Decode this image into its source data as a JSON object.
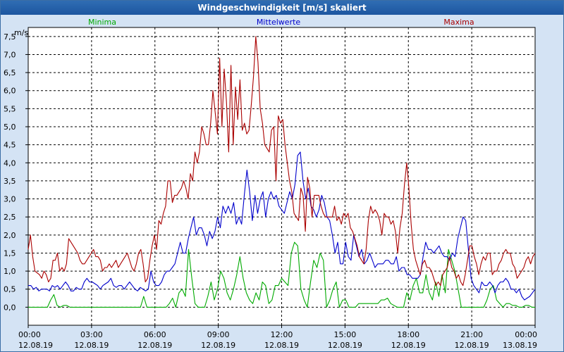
{
  "window": {
    "title": "Windgeschwindigkeit [m/s] skaliert"
  },
  "chart_data": {
    "type": "line",
    "title": "Windgeschwindigkeit [m/s] skaliert",
    "ylabel": "m/s",
    "xlabel": "",
    "ylim": [
      -0.5,
      7.75
    ],
    "xlim": [
      "12.08.19 00:00",
      "13.08.19 00:00"
    ],
    "x_step_minutes": 10,
    "grid": true,
    "legend_position": "top",
    "ytick_values": [
      0,
      0.5,
      1,
      1.5,
      2,
      2.5,
      3,
      3.5,
      4,
      4.5,
      5,
      5.5,
      6,
      6.5,
      7,
      7.5
    ],
    "ytick_labels": [
      "0,0",
      "0,5",
      "1,0",
      "1,5",
      "2,0",
      "2,5",
      "3,0",
      "3,5",
      "4,0",
      "4,5",
      "5,0",
      "5,5",
      "6,0",
      "6,5",
      "7,0",
      "7,5"
    ],
    "xtick_times": [
      "00:00",
      "03:00",
      "06:00",
      "09:00",
      "12:00",
      "15:00",
      "18:00",
      "21:00",
      "00:00"
    ],
    "xtick_dates": [
      "12.08.19",
      "12.08.19",
      "12.08.19",
      "12.08.19",
      "12.08.19",
      "12.08.19",
      "12.08.19",
      "12.08.19",
      "13.08.19"
    ],
    "series": [
      {
        "name": "Minima",
        "color": "#00aa00",
        "values": [
          0,
          0,
          0,
          0,
          0,
          0,
          0,
          0.2,
          0.35,
          0.05,
          0,
          0.05,
          0.05,
          0,
          0,
          0,
          0,
          0,
          0,
          0,
          0,
          0,
          0,
          0,
          0,
          0,
          0,
          0,
          0,
          0,
          0,
          0,
          0,
          0,
          0,
          0,
          0.3,
          0,
          0,
          0,
          0,
          0,
          0,
          0,
          0.1,
          0.25,
          0,
          0.4,
          0.5,
          0.3,
          1.6,
          0.8,
          0.1,
          0,
          0,
          0,
          0.3,
          0.7,
          0.2,
          0.5,
          1.0,
          0.8,
          0.4,
          0.2,
          0.5,
          0.9,
          1.4,
          0.8,
          0.4,
          0.2,
          0.1,
          0.4,
          0.2,
          0.7,
          0.6,
          0.1,
          0.2,
          0.6,
          0.6,
          0.8,
          0.7,
          0.6,
          1.5,
          1.8,
          1.7,
          0.5,
          0.2,
          0,
          0.7,
          1.3,
          1.1,
          1.5,
          1.3,
          0,
          0.2,
          0.5,
          0.7,
          0,
          0.2,
          0.2,
          0,
          0,
          0,
          0.1,
          0.1,
          0.1,
          0.1,
          0.1,
          0.1,
          0.1,
          0.2,
          0.2,
          0.25,
          0.1,
          0.05,
          0,
          0,
          0,
          0.4,
          0.2,
          0.6,
          0.8,
          0.4,
          0.4,
          0.9,
          0.4,
          0.2,
          0.7,
          0.3,
          0.9,
          0.4,
          1.6,
          1.3,
          1.0,
          0.5,
          0,
          0,
          0,
          0,
          0,
          0,
          0,
          0,
          0.2,
          0.5,
          0.6,
          0.2,
          0.1,
          0,
          0.1,
          0.1,
          0.05,
          0.05,
          0,
          0,
          0.05,
          0.05,
          0,
          0
        ]
      },
      {
        "name": "Mittelwerte",
        "color": "#0000cc",
        "values": [
          0.6,
          0.6,
          0.5,
          0.55,
          0.45,
          0.5,
          0.5,
          0.5,
          0.45,
          0.6,
          0.55,
          0.6,
          0.5,
          0.6,
          0.7,
          0.6,
          0.45,
          0.45,
          0.55,
          0.5,
          0.5,
          0.7,
          0.8,
          0.7,
          0.7,
          0.65,
          0.6,
          0.5,
          0.6,
          0.65,
          0.7,
          0.8,
          0.6,
          0.55,
          0.6,
          0.6,
          0.5,
          0.6,
          0.7,
          0.6,
          0.5,
          0.45,
          0.55,
          0.5,
          0.45,
          0.5,
          1.0,
          0.7,
          0.6,
          0.6,
          0.7,
          0.9,
          1.0,
          1.0,
          1.1,
          1.2,
          1.5,
          1.8,
          1.5,
          1.5,
          1.9,
          2.2,
          2.5,
          2.0,
          2.2,
          2.2,
          2.0,
          1.7,
          2.1,
          1.9,
          2.1,
          2.5,
          2.2,
          2.8,
          2.6,
          2.8,
          2.6,
          2.9,
          2.3,
          2.5,
          2.3,
          3.1,
          3.8,
          3.2,
          2.4,
          3.1,
          2.6,
          3.0,
          3.2,
          2.5,
          3.0,
          3.2,
          3.0,
          3.1,
          2.8,
          2.7,
          2.6,
          2.9,
          3.2,
          3.0,
          3.4,
          4.2,
          4.3,
          3.5,
          3.0,
          3.3,
          2.8,
          2.7,
          2.5,
          2.7,
          3.1,
          2.9,
          2.5,
          2.4,
          2.0,
          1.5,
          1.8,
          1.2,
          1.2,
          1.8,
          1.4,
          1.3,
          2.0,
          1.7,
          1.4,
          1.6,
          1.2,
          1.3,
          1.5,
          1.3,
          1.1,
          1.2,
          1.2,
          1.2,
          1.3,
          1.3,
          1.2,
          1.2,
          1.4,
          1.0,
          1.1,
          1.1,
          0.9,
          0.9,
          0.8,
          0.8,
          0.8,
          0.9,
          1.4,
          1.8,
          1.6,
          1.6,
          1.5,
          1.6,
          1.7,
          1.5,
          1.4,
          1.4,
          1.3,
          1.5,
          1.4,
          1.9,
          2.2,
          2.5,
          2.4,
          1.6,
          0.8,
          0.6,
          0.5,
          0.4,
          0.7,
          0.6,
          0.6,
          0.7,
          0.6,
          0.4,
          0.6,
          0.7,
          0.7,
          0.8,
          0.7,
          0.5,
          0.5,
          0.4,
          0.5,
          0.3,
          0.2,
          0.25,
          0.3,
          0.4,
          0.5
        ]
      },
      {
        "name": "Maxima",
        "color": "#aa0000",
        "values": [
          1.6,
          2.0,
          1.4,
          1.0,
          0.95,
          0.9,
          0.8,
          1.0,
          0.9,
          0.7,
          0.8,
          1.3,
          1.3,
          1.5,
          1.0,
          1.1,
          1.0,
          1.2,
          1.9,
          1.8,
          1.7,
          1.6,
          1.5,
          1.3,
          1.2,
          1.2,
          1.3,
          1.4,
          1.5,
          1.6,
          1.4,
          1.4,
          1.3,
          1.0,
          1.1,
          1.1,
          1.2,
          1.1,
          1.2,
          1.3,
          1.1,
          1.2,
          1.3,
          1.4,
          1.5,
          1.3,
          1.1,
          1.0,
          1.2,
          1.5,
          1.6,
          1.2,
          0.7,
          0.8,
          1.3,
          1.7,
          2.0,
          1.6,
          2.4,
          2.3,
          2.6,
          2.8,
          3.5,
          3.5,
          2.9,
          3.1,
          3.1,
          3.2,
          3.3,
          3.5,
          3.3,
          3.0,
          3.7,
          3.5,
          4.3,
          4.0,
          4.3,
          5.0,
          4.8,
          4.5,
          4.5,
          5.1,
          6.0,
          5.4,
          4.8,
          6.9,
          5.0,
          6.6,
          5.7,
          4.3,
          6.7,
          4.5,
          6.1,
          5.2,
          6.3,
          4.9,
          5.1,
          4.8,
          4.9,
          5.6,
          6.4,
          7.5,
          6.8,
          5.5,
          5.1,
          4.5,
          4.4,
          4.3,
          4.9,
          5.0,
          3.5,
          5.3,
          5.1,
          5.2,
          4.5,
          4.0,
          3.5,
          3.2,
          2.6,
          2.5,
          2.4,
          3.3,
          3.1,
          2.1,
          3.6,
          3.3,
          2.5,
          3.1,
          3.1,
          3.1,
          2.8,
          2.6,
          2.5,
          2.5,
          2.5,
          2.5,
          2.8,
          2.4,
          2.5,
          2.3,
          2.6,
          2.5,
          2.6,
          2.2,
          2.1,
          1.9,
          1.7,
          1.4,
          1.3,
          1.2,
          1.6,
          2.4,
          2.8,
          2.6,
          2.7,
          2.6,
          2.4,
          2.0,
          2.6,
          2.5,
          2.5,
          2.3,
          2.4,
          2.1,
          1.5,
          2.2,
          2.6,
          3.4,
          4.0,
          3.3,
          2.3,
          1.6,
          1.3,
          1.1,
          0.9,
          1.2,
          1.3,
          1.1,
          1.1,
          1.0,
          0.8,
          0.6,
          0.7,
          0.6,
          0.9,
          1.0,
          1.1,
          1.4,
          1.1,
          1.0,
          0.8,
          0.9,
          0.7,
          0.6,
          0.9,
          1.3,
          1.7,
          1.7,
          1.4,
          1.2,
          0.9,
          1.2,
          1.4,
          1.3,
          1.5,
          1.5,
          0.9,
          1.0,
          1.0,
          1.2,
          1.3,
          1.5,
          1.6,
          1.5,
          1.5,
          1.2,
          1.1,
          0.8,
          0.9,
          1.0,
          1.1,
          1.3,
          1.4,
          1.2,
          1.4,
          1.5
        ]
      }
    ]
  }
}
